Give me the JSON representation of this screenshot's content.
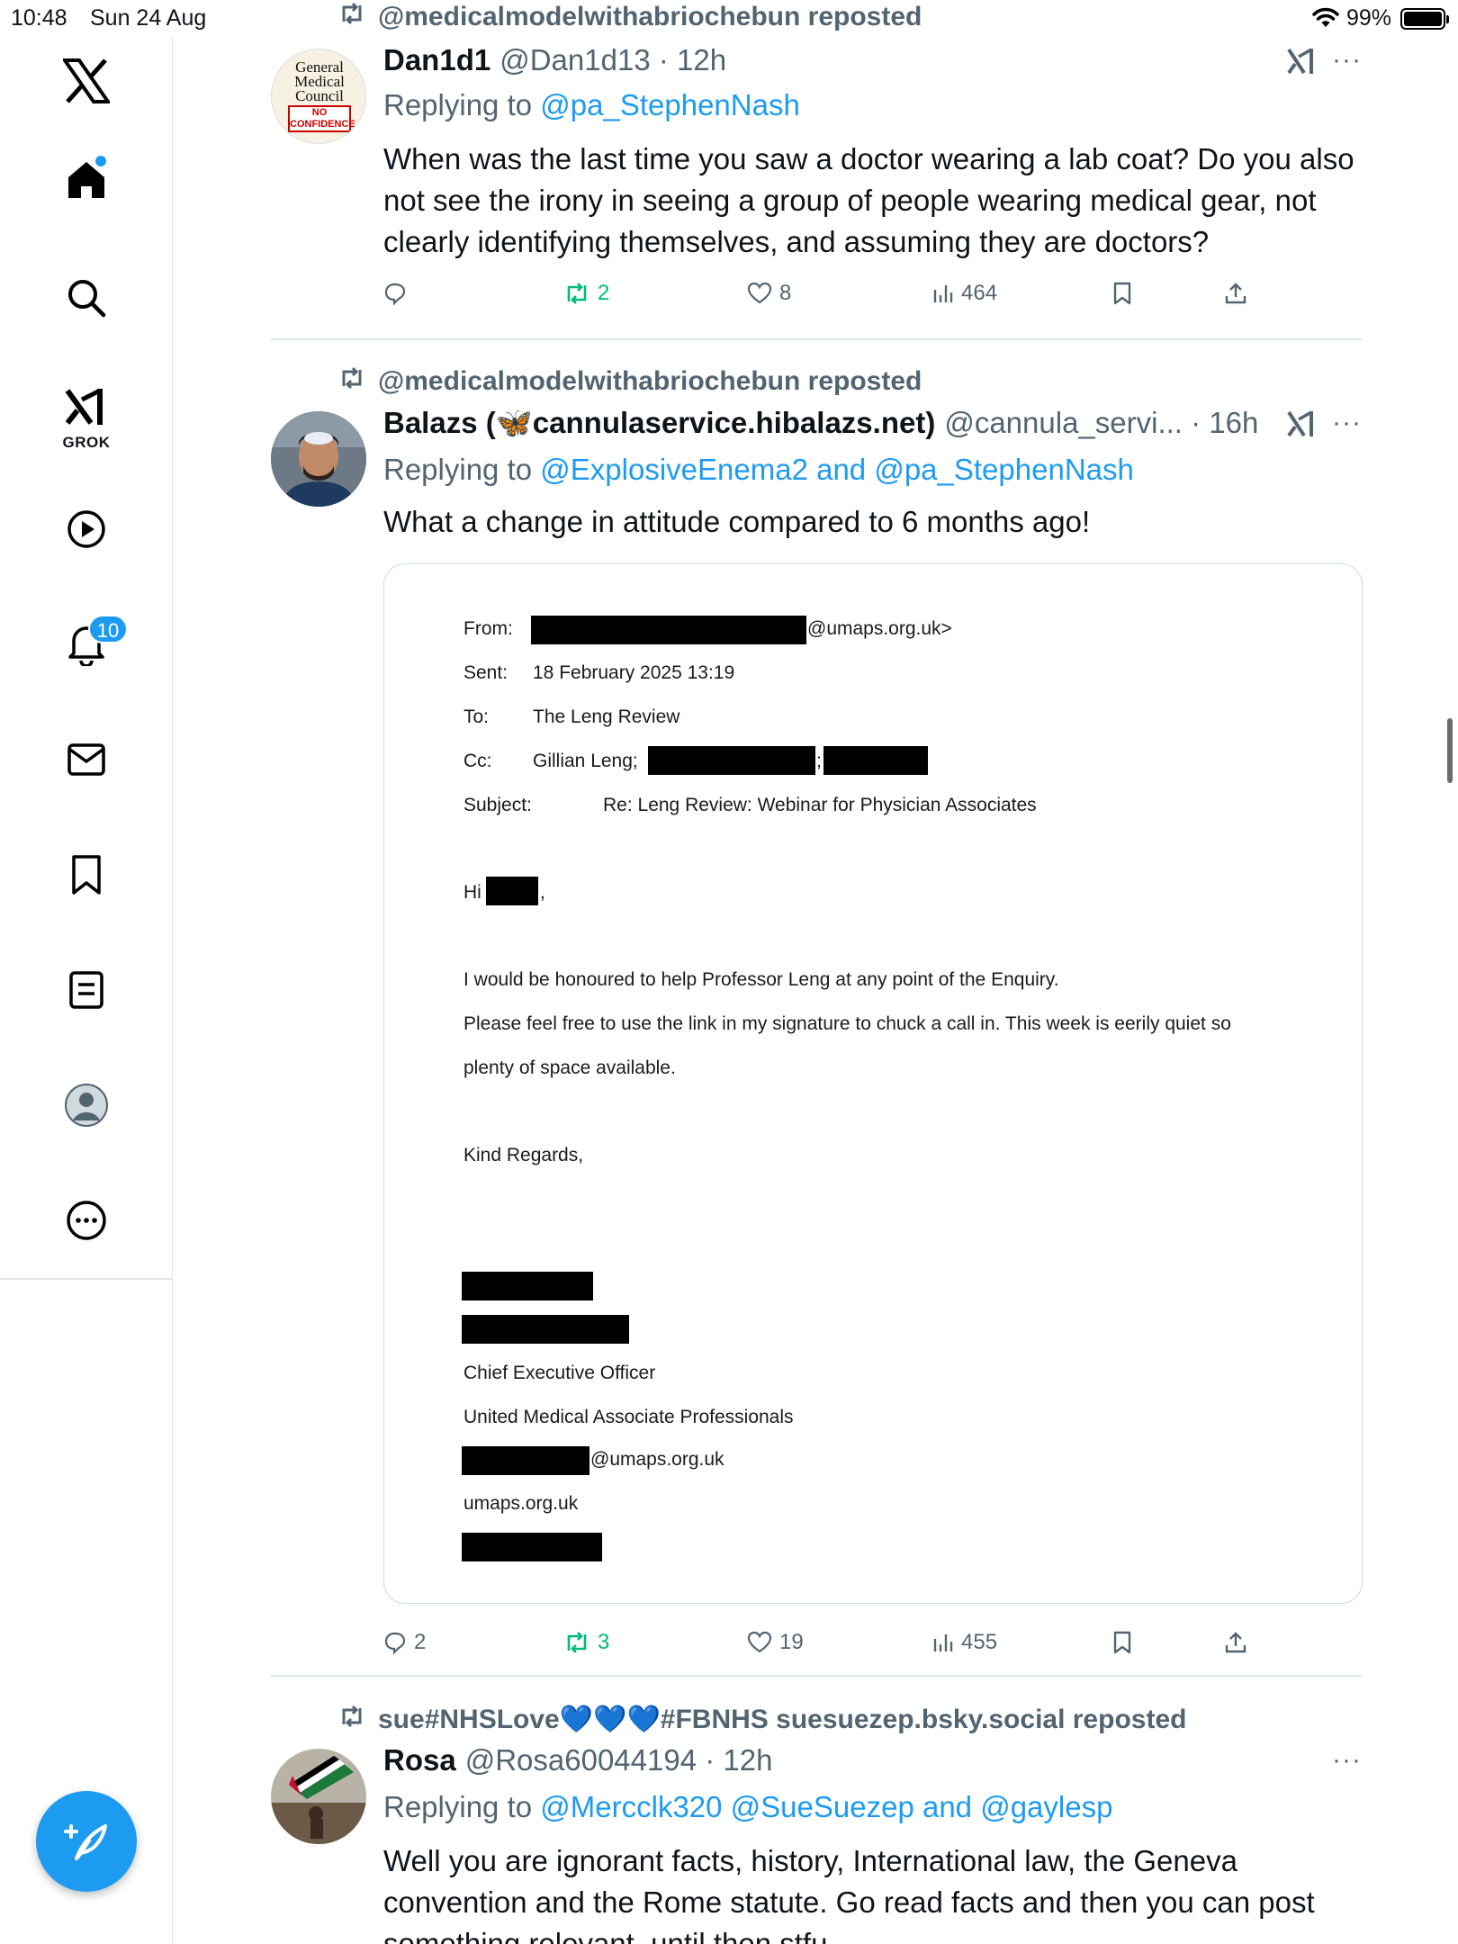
{
  "status_bar": {
    "time": "10:48",
    "date": "Sun 24 Aug",
    "battery": "99%"
  },
  "sidebar": {
    "grok_label": "GROK",
    "notifications_badge": "10",
    "items": [
      "home-icon",
      "search-icon",
      "grok-icon",
      "video-icon",
      "notifications-icon",
      "messages-icon",
      "bookmarks-icon",
      "lists-icon",
      "profile-icon",
      "more-icon"
    ]
  },
  "tweets": [
    {
      "reposted_by": "@medicalmodelwithabriochebun reposted",
      "display_name": "Dan1d1",
      "handle": "@Dan1d13 · 12h",
      "avatar_text": [
        "General",
        "Medical",
        "Council",
        "NO",
        "CONFIDENCE"
      ],
      "replying_label": "Replying to",
      "replying_to": "@pa_StephenNash",
      "text": "When was the last time you saw a doctor wearing a lab coat? Do you also not see the irony in seeing a group of people wearing medical gear, not clearly identifying themselves, and assuming they are doctors?",
      "replies": "",
      "reposts": "2",
      "likes": "8",
      "views": "464"
    },
    {
      "reposted_by": "@medicalmodelwithabriochebun reposted",
      "display_name": "Balazs (🦋cannulaservice.hibalazs.net)",
      "handle": "@cannula_servi... · 16h",
      "replying_label": "Replying to",
      "replying_to": "@ExplosiveEnema2 and @pa_StephenNash",
      "text": "What a change in attitude compared to 6 months ago!",
      "replies": "2",
      "reposts": "3",
      "likes": "19",
      "views": "455"
    },
    {
      "reposted_by": "sue#NHSLove💙💙💙#FBNHS suesuezep.bsky.social reposted",
      "display_name": "Rosa",
      "handle": "@Rosa60044194 · 12h",
      "replying_label": "Replying to",
      "replying_to": "@Mercclk320 @SueSuezep and @gaylesp",
      "text": "Well you are ignorant facts, history, International law, the Geneva convention and the Rome statute. Go read facts and then you can post something relevant, until then stfu"
    }
  ],
  "email": {
    "from_label": "From:",
    "from_value": "@umaps.org.uk>",
    "sent_label": "Sent:",
    "sent_value": "18 February 2025 13:19",
    "to_label": "To:",
    "to_value": "The Leng Review",
    "cc_label": "Cc:",
    "cc_value": "Gillian Leng;",
    "cc_sep": ";",
    "subject_label": "Subject:",
    "subject_value": "Re: Leng Review: Webinar for Physician Associates",
    "greeting": "Hi",
    "greeting_end": ",",
    "body_line1": "I would be honoured to help Professor Leng at any point of the Enquiry.",
    "body_line2": "Please feel free to use the link in my signature to chuck a call in. This week is eerily quiet so",
    "body_line3": "plenty of space available.",
    "closing": "Kind Regards,",
    "sig_title": "Chief Executive Officer",
    "sig_org": "United Medical Associate Professionals",
    "sig_email": "@umaps.org.uk",
    "sig_web": "umaps.org.uk"
  }
}
